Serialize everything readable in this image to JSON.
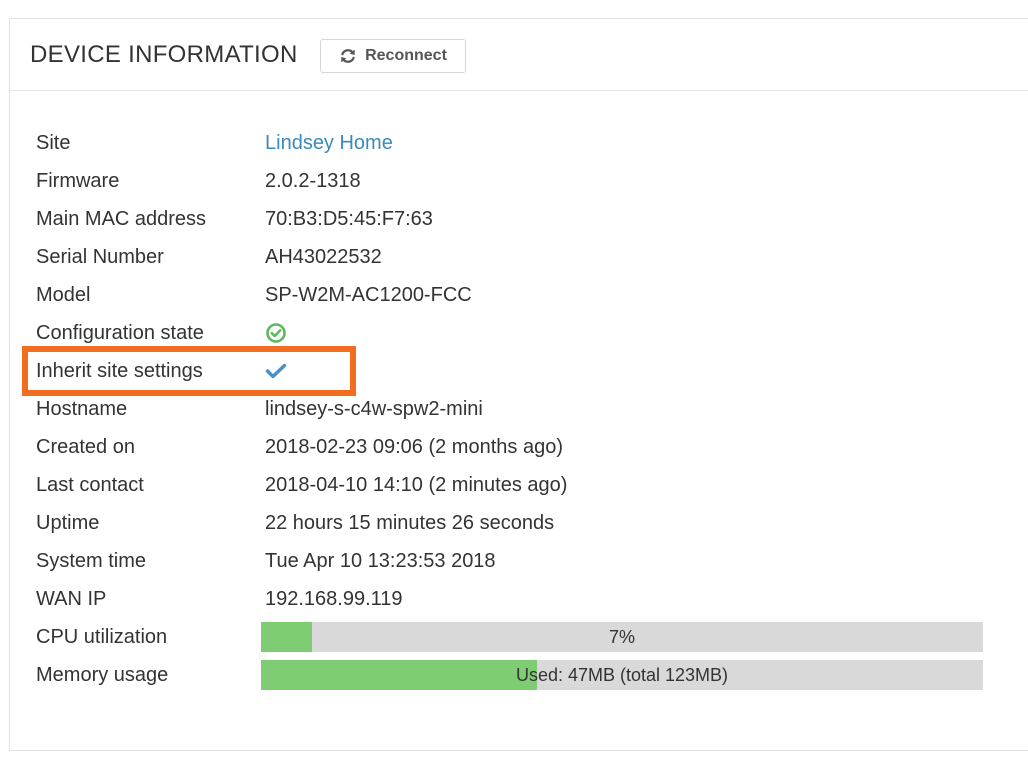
{
  "header": {
    "title": "DEVICE INFORMATION",
    "reconnect_label": "Reconnect"
  },
  "rows": [
    {
      "label": "Site",
      "value": "Lindsey Home"
    },
    {
      "label": "Firmware",
      "value": "2.0.2-1318"
    },
    {
      "label": "Main MAC address",
      "value": "70:B3:D5:45:F7:63"
    },
    {
      "label": "Serial Number",
      "value": "AH43022532"
    },
    {
      "label": "Model",
      "value": "SP-W2M-AC1200-FCC"
    },
    {
      "label": "Configuration state",
      "icon": "check-circle-icon"
    },
    {
      "label": "Inherit site settings",
      "icon": "checkmark-icon"
    },
    {
      "label": "Hostname",
      "value": "lindsey-s-c4w-spw2-mini"
    },
    {
      "label": "Created on",
      "value": "2018-02-23 09:06 (2 months ago)"
    },
    {
      "label": "Last contact",
      "value": "2018-04-10 14:10 (2 minutes ago)"
    },
    {
      "label": "Uptime",
      "value": "22 hours 15 minutes 26 seconds"
    },
    {
      "label": "System time",
      "value": "Tue Apr 10 13:23:53 2018"
    },
    {
      "label": "WAN IP",
      "value": "192.168.99.119"
    },
    {
      "label": "CPU utilization",
      "bar_text": "7%",
      "fraction": 0.07
    },
    {
      "label": "Memory usage",
      "bar_text": "Used: 47MB (total 123MB)",
      "fraction": 0.382
    }
  ],
  "colors": {
    "link": "#3a8bbb",
    "bar_fill": "#7fcd72",
    "bar_track": "#d9d9d9",
    "config_ok": "#5cb85c",
    "inherit_check": "#4a90c8",
    "highlight": "#f36d21"
  }
}
